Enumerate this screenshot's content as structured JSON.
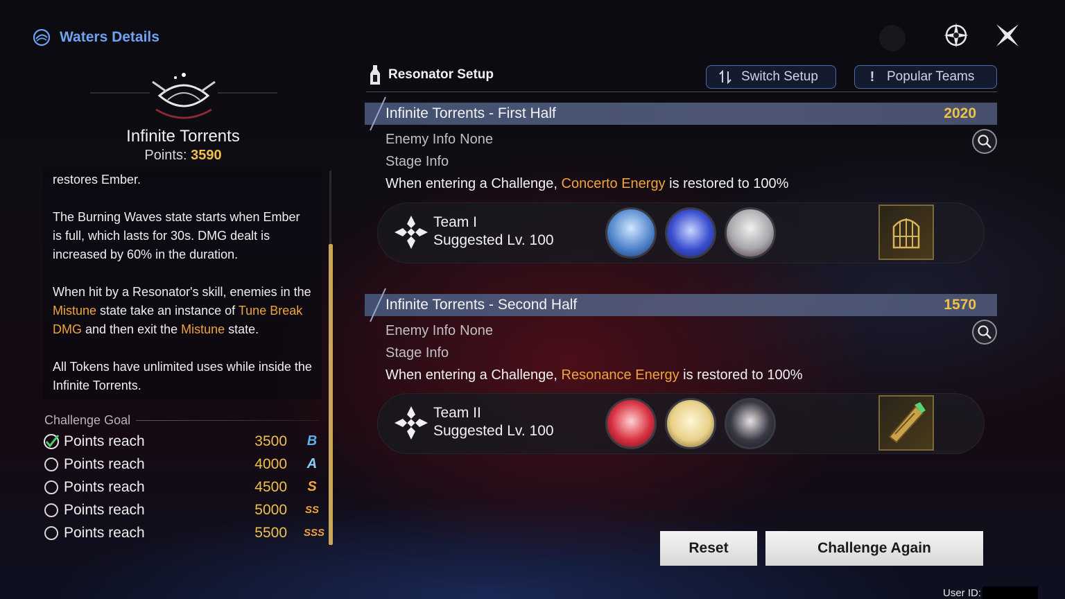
{
  "header": {
    "title": "Waters Details"
  },
  "tower": {
    "name": "Infinite Torrents",
    "points_label": "Points:",
    "points_value": "3590"
  },
  "description": {
    "p1": "restores Ember.",
    "p2": "The Burning Waves state starts when Ember is full, which lasts for 30s. DMG dealt is increased by 60% in the duration.",
    "p3_a": "When hit by a Resonator's skill, enemies in the ",
    "p3_b": "Mistune",
    "p3_c": " state take an instance of ",
    "p3_d": "Tune Break DMG",
    "p3_e": " and then exit the ",
    "p3_f": "Mistune",
    "p3_g": " state.",
    "p4": "All Tokens have unlimited uses while inside the Infinite Torrents."
  },
  "challenge_goal": {
    "title": "Challenge Goal",
    "rows": [
      {
        "label": "Points reach",
        "value": "3500",
        "rank": "B",
        "done": true
      },
      {
        "label": "Points reach",
        "value": "4000",
        "rank": "A",
        "done": false
      },
      {
        "label": "Points reach",
        "value": "4500",
        "rank": "S",
        "done": false
      },
      {
        "label": "Points reach",
        "value": "5000",
        "rank": "SS",
        "done": false
      },
      {
        "label": "Points reach",
        "value": "5500",
        "rank": "SSS",
        "done": false
      }
    ]
  },
  "setup": {
    "title": "Resonator Setup",
    "switch_label": "Switch Setup",
    "popular_label": "Popular Teams"
  },
  "halves": [
    {
      "name": "Infinite Torrents - First Half",
      "score": "2020",
      "enemy_label": "Enemy Info",
      "enemy_value": "None",
      "stage_label": "Stage Info",
      "cond_a": "When entering a Challenge, ",
      "cond_hl": "Concerto Energy",
      "cond_b": " is restored to 100%",
      "team_name": "Team I",
      "team_level": "Suggested Lv. 100"
    },
    {
      "name": "Infinite Torrents - Second Half",
      "score": "1570",
      "enemy_label": "Enemy Info",
      "enemy_value": "None",
      "stage_label": "Stage Info",
      "cond_a": "When entering a Challenge, ",
      "cond_hl": "Resonance Energy",
      "cond_b": " is restored to 100%",
      "team_name": "Team II",
      "team_level": "Suggested Lv. 100"
    }
  ],
  "buttons": {
    "reset": "Reset",
    "again": "Challenge Again"
  },
  "footer": {
    "user_id_label": "User ID:"
  },
  "colors": {
    "accent_blue": "#6ea3f0",
    "gold": "#f0c14a",
    "orange": "#f0a43a",
    "bar": "#56628a"
  },
  "icons": [
    "tower-icon",
    "compass-icon",
    "close-icon",
    "resonator-icon",
    "switch-icon",
    "alert-icon",
    "search-icon",
    "team-icon",
    "check-icon",
    "circle-icon"
  ]
}
